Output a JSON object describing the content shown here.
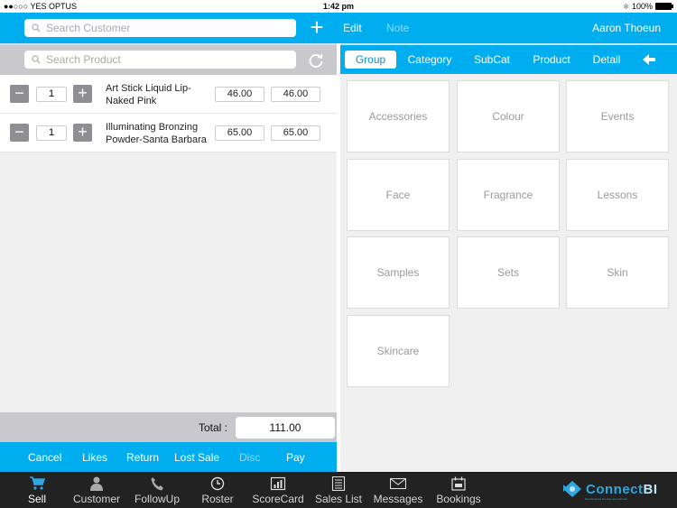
{
  "status_bar": {
    "carrier": "●●○○○ YES OPTUS",
    "time": "1:42 pm",
    "battery": "100%"
  },
  "header": {
    "search_customer_placeholder": "Search Customer",
    "add_label": "+",
    "edit_label": "Edit",
    "note_label": "Note",
    "user_name": "Aaron Thoeun"
  },
  "cart": {
    "search_product_placeholder": "Search Product",
    "items": [
      {
        "qty": "1",
        "name": "Art Stick Liquid Lip-Naked Pink",
        "unit_price": "46.00",
        "line_total": "46.00"
      },
      {
        "qty": "1",
        "name": "Illuminating Bronzing Powder-Santa Barbara",
        "unit_price": "65.00",
        "line_total": "65.00"
      }
    ],
    "total_label": "Total :",
    "total_value": "111.00",
    "actions": [
      {
        "label": "Cancel",
        "enabled": true
      },
      {
        "label": "Likes",
        "enabled": true
      },
      {
        "label": "Return",
        "enabled": true
      },
      {
        "label": "Lost Sale",
        "enabled": true
      },
      {
        "label": "Disc",
        "enabled": false
      },
      {
        "label": "Pay",
        "enabled": true
      }
    ]
  },
  "browser": {
    "tabs": [
      {
        "label": "Group",
        "active": true
      },
      {
        "label": "Category",
        "active": false
      },
      {
        "label": "SubCat",
        "active": false
      },
      {
        "label": "Product",
        "active": false
      },
      {
        "label": "Detail",
        "active": false
      }
    ],
    "back_icon": "arrow-left-icon",
    "groups": [
      "Accessories",
      "Colour",
      "Events",
      "Face",
      "Fragrance",
      "Lessons",
      "Samples",
      "Sets",
      "Skin",
      "Skincare"
    ]
  },
  "tab_bar": {
    "items": [
      {
        "label": "Sell",
        "icon": "cart-icon",
        "active": true
      },
      {
        "label": "Customer",
        "icon": "person-icon",
        "active": false
      },
      {
        "label": "FollowUp",
        "icon": "phone-icon",
        "active": false
      },
      {
        "label": "Roster",
        "icon": "clock-icon",
        "active": false
      },
      {
        "label": "ScoreCard",
        "icon": "bar-chart-icon",
        "active": false
      },
      {
        "label": "Sales List",
        "icon": "list-icon",
        "active": false
      },
      {
        "label": "Messages",
        "icon": "envelope-icon",
        "active": false
      },
      {
        "label": "Bookings",
        "icon": "calendar-icon",
        "active": false
      }
    ],
    "logo_text": "Connect",
    "logo_text_bi": "BI",
    "logo_tagline": "Revolutionise the way you Connect"
  },
  "colors": {
    "accent": "#00aeef",
    "toolbar_gray": "#c8c8cd",
    "tabbar_bg": "#222222",
    "active_tab_text": "#0a8fd3"
  }
}
